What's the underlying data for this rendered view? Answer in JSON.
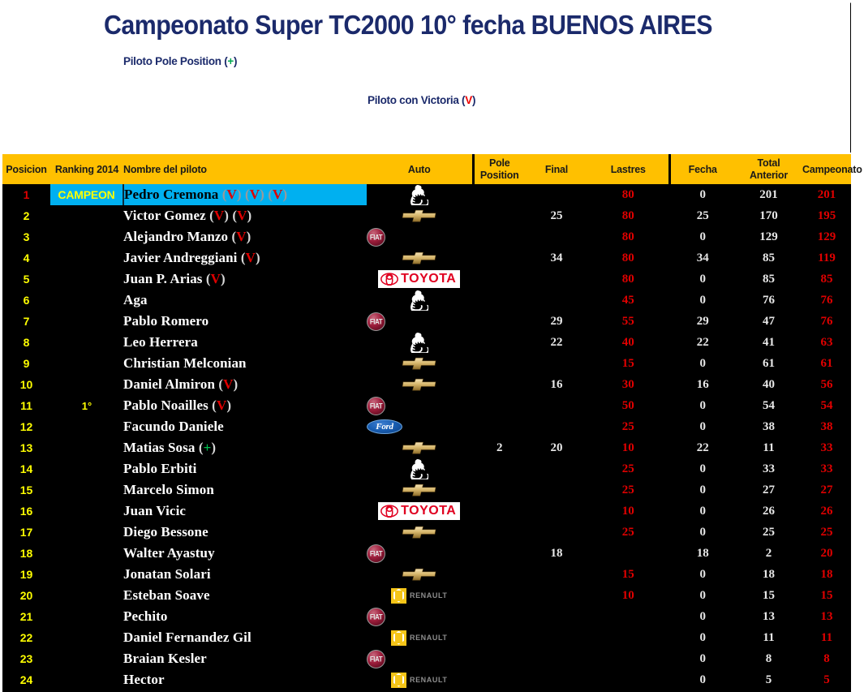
{
  "header": {
    "title": "Campeonato Super TC2000 10° fecha BUENOS AIRES",
    "legend_pole_text": "Piloto Pole Position",
    "legend_pole_symbol": "+",
    "legend_win_text": "Piloto con Victoria",
    "legend_win_symbol": "V",
    "paren_open": "(",
    "paren_close": ")"
  },
  "colors": {
    "header_bg": "#ffc000",
    "header_text": "#1a1a1a",
    "title_text": "#1b2a6b",
    "table_bg": "#000000",
    "position_text": "#ffff00",
    "name_text": "#ffffff",
    "red_value": "#e00000",
    "white_value": "#e8e8e8",
    "champion_bg": "#00b0f0",
    "champion_label": "#ffff00",
    "win_mark": "#e00000",
    "pole_mark": "#00c050"
  },
  "columns": {
    "posicion": "Posicion",
    "ranking": "Ranking 2014",
    "nombre": "Nombre del piloto",
    "auto": "Auto",
    "pole_line1": "Pole",
    "pole_line2": "Position",
    "final": "Final",
    "lastres": "Lastres",
    "fecha": "Fecha",
    "total_line1": "Total",
    "total_line2": "Anterior",
    "campeonato": "Campeonato"
  },
  "champion_badge": "CAMPEON",
  "rows": [
    {
      "pos": "1",
      "rank": "",
      "name": "Pedro Cremona",
      "marks": [
        "V",
        "V",
        "V"
      ],
      "auto": "peugeot",
      "pole": "",
      "final": "",
      "lastres": "80",
      "fecha": "0",
      "total": "201",
      "camp": "201",
      "champion": true
    },
    {
      "pos": "2",
      "rank": "",
      "name": "Victor Gomez",
      "marks": [
        "V",
        "V"
      ],
      "auto": "chevrolet",
      "pole": "",
      "final": "25",
      "lastres": "80",
      "fecha": "25",
      "total": "170",
      "camp": "195",
      "champion": false
    },
    {
      "pos": "3",
      "rank": "",
      "name": "Alejandro Manzo",
      "marks": [
        "V"
      ],
      "auto": "fiat",
      "pole": "",
      "final": "",
      "lastres": "80",
      "fecha": "0",
      "total": "129",
      "camp": "129",
      "champion": false
    },
    {
      "pos": "4",
      "rank": "",
      "name": "Javier Andreggiani",
      "marks": [
        "V"
      ],
      "auto": "chevrolet",
      "pole": "",
      "final": "34",
      "lastres": "80",
      "fecha": "34",
      "total": "85",
      "camp": "119",
      "champion": false
    },
    {
      "pos": "5",
      "rank": "",
      "name": "Juan P. Arias",
      "marks": [
        "V"
      ],
      "auto": "toyota",
      "pole": "",
      "final": "",
      "lastres": "80",
      "fecha": "0",
      "total": "85",
      "camp": "85",
      "champion": false
    },
    {
      "pos": "6",
      "rank": "",
      "name": "Aga",
      "marks": [],
      "auto": "peugeot",
      "pole": "",
      "final": "",
      "lastres": "45",
      "fecha": "0",
      "total": "76",
      "camp": "76",
      "champion": false
    },
    {
      "pos": "7",
      "rank": "",
      "name": "Pablo Romero",
      "marks": [],
      "auto": "fiat",
      "pole": "",
      "final": "29",
      "lastres": "55",
      "fecha": "29",
      "total": "47",
      "camp": "76",
      "champion": false
    },
    {
      "pos": "8",
      "rank": "",
      "name": "Leo Herrera",
      "marks": [],
      "auto": "peugeot",
      "pole": "",
      "final": "22",
      "lastres": "40",
      "fecha": "22",
      "total": "41",
      "camp": "63",
      "champion": false
    },
    {
      "pos": "9",
      "rank": "",
      "name": "Christian Melconian",
      "marks": [],
      "auto": "chevrolet",
      "pole": "",
      "final": "",
      "lastres": "15",
      "fecha": "0",
      "total": "61",
      "camp": "61",
      "champion": false
    },
    {
      "pos": "10",
      "rank": "",
      "name": "Daniel Almiron",
      "marks": [
        "V"
      ],
      "auto": "chevrolet",
      "pole": "",
      "final": "16",
      "lastres": "30",
      "fecha": "16",
      "total": "40",
      "camp": "56",
      "champion": false
    },
    {
      "pos": "11",
      "rank": "1°",
      "name": "Pablo Noailles",
      "marks": [
        "V"
      ],
      "auto": "fiat",
      "pole": "",
      "final": "",
      "lastres": "50",
      "fecha": "0",
      "total": "54",
      "camp": "54",
      "champion": false
    },
    {
      "pos": "12",
      "rank": "",
      "name": "Facundo Daniele",
      "marks": [],
      "auto": "ford",
      "pole": "",
      "final": "",
      "lastres": "25",
      "fecha": "0",
      "total": "38",
      "camp": "38",
      "champion": false
    },
    {
      "pos": "13",
      "rank": "",
      "name": "Matias Sosa",
      "marks": [
        "+"
      ],
      "auto": "chevrolet",
      "pole": "2",
      "final": "20",
      "lastres": "10",
      "fecha": "22",
      "total": "11",
      "camp": "33",
      "champion": false
    },
    {
      "pos": "14",
      "rank": "",
      "name": "Pablo Erbiti",
      "marks": [],
      "auto": "peugeot",
      "pole": "",
      "final": "",
      "lastres": "25",
      "fecha": "0",
      "total": "33",
      "camp": "33",
      "champion": false
    },
    {
      "pos": "15",
      "rank": "",
      "name": "Marcelo Simon",
      "marks": [],
      "auto": "chevrolet",
      "pole": "",
      "final": "",
      "lastres": "25",
      "fecha": "0",
      "total": "27",
      "camp": "27",
      "champion": false
    },
    {
      "pos": "16",
      "rank": "",
      "name": "Juan Vicic",
      "marks": [],
      "auto": "toyota",
      "pole": "",
      "final": "",
      "lastres": "10",
      "fecha": "0",
      "total": "26",
      "camp": "26",
      "champion": false
    },
    {
      "pos": "17",
      "rank": "",
      "name": "Diego Bessone",
      "marks": [],
      "auto": "chevrolet",
      "pole": "",
      "final": "",
      "lastres": "25",
      "fecha": "0",
      "total": "25",
      "camp": "25",
      "champion": false
    },
    {
      "pos": "18",
      "rank": "",
      "name": "Walter Ayastuy",
      "marks": [],
      "auto": "fiat",
      "pole": "",
      "final": "18",
      "lastres": "",
      "fecha": "18",
      "total": "2",
      "camp": "20",
      "champion": false
    },
    {
      "pos": "19",
      "rank": "",
      "name": "Jonatan Solari",
      "marks": [],
      "auto": "chevrolet",
      "pole": "",
      "final": "",
      "lastres": "15",
      "fecha": "0",
      "total": "18",
      "camp": "18",
      "champion": false
    },
    {
      "pos": "20",
      "rank": "",
      "name": "Esteban Soave",
      "marks": [],
      "auto": "renault",
      "pole": "",
      "final": "",
      "lastres": "10",
      "fecha": "0",
      "total": "15",
      "camp": "15",
      "champion": false
    },
    {
      "pos": "21",
      "rank": "",
      "name": "Pechito",
      "marks": [],
      "auto": "fiat",
      "pole": "",
      "final": "",
      "lastres": "",
      "fecha": "0",
      "total": "13",
      "camp": "13",
      "champion": false
    },
    {
      "pos": "22",
      "rank": "",
      "name": "Daniel Fernandez Gil",
      "marks": [],
      "auto": "renault",
      "pole": "",
      "final": "",
      "lastres": "",
      "fecha": "0",
      "total": "11",
      "camp": "11",
      "champion": false
    },
    {
      "pos": "23",
      "rank": "",
      "name": "Braian Kesler",
      "marks": [],
      "auto": "fiat",
      "pole": "",
      "final": "",
      "lastres": "",
      "fecha": "0",
      "total": "8",
      "camp": "8",
      "champion": false
    },
    {
      "pos": "24",
      "rank": "",
      "name": "Hector",
      "marks": [],
      "auto": "renault",
      "pole": "",
      "final": "",
      "lastres": "",
      "fecha": "0",
      "total": "5",
      "camp": "5",
      "champion": false
    }
  ]
}
